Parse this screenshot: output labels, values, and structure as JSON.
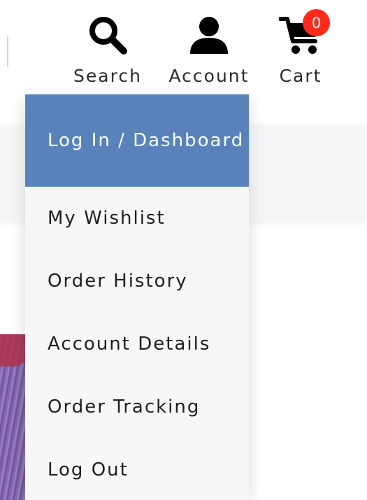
{
  "header": {
    "nav": [
      {
        "label": "Search",
        "icon": "search-icon"
      },
      {
        "label": "Account",
        "icon": "user-icon"
      },
      {
        "label": "Cart",
        "icon": "cart-icon"
      }
    ],
    "cart_count": "0"
  },
  "account_menu": {
    "items": [
      {
        "label": "Log In / Dashboard"
      },
      {
        "label": "My Wishlist"
      },
      {
        "label": "Order History"
      },
      {
        "label": "Account Details"
      },
      {
        "label": "Order Tracking"
      },
      {
        "label": "Log Out"
      }
    ]
  },
  "colors": {
    "active_item": "#5882b9",
    "badge": "#ff2a1a",
    "menu_background": "#f7f7f7",
    "band_background": "#f5f6f8"
  }
}
